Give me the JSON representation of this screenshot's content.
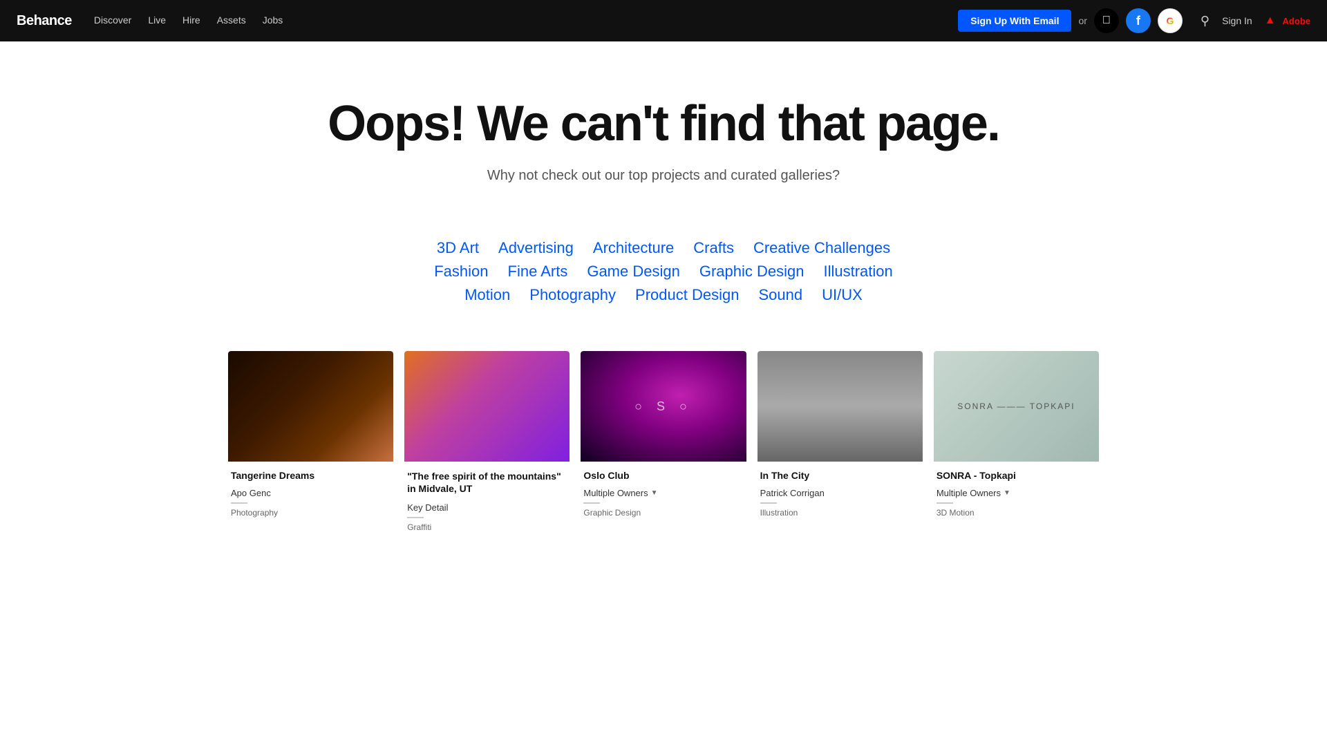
{
  "navbar": {
    "logo": "Behance",
    "links": [
      "Discover",
      "Live",
      "Hire",
      "Assets",
      "Jobs"
    ],
    "signup_label": "Sign Up With Email",
    "or_label": "or",
    "signin_label": "Sign In",
    "adobe_label": "Adobe",
    "apple_icon": "",
    "facebook_icon": "f",
    "google_icon": "G",
    "search_icon": "🔍"
  },
  "hero": {
    "title": "Oops! We can't find that page.",
    "subtitle": "Why not check out our top projects and curated galleries?"
  },
  "tags": {
    "row1": [
      "3D Art",
      "Advertising",
      "Architecture",
      "Crafts",
      "Creative Challenges"
    ],
    "row2": [
      "Fashion",
      "Fine Arts",
      "Game Design",
      "Graphic Design",
      "Illustration"
    ],
    "row3": [
      "Motion",
      "Photography",
      "Product Design",
      "Sound",
      "UI/UX"
    ]
  },
  "projects": [
    {
      "title": "Tangerine Dreams",
      "author": "Apo Genc",
      "category": "Photography",
      "thumb_class": "thumb-1"
    },
    {
      "title": "\"The free spirit of the mountains\" in Midvale, UT",
      "author": "Key Detail",
      "category": "Graffiti",
      "thumb_class": "thumb-2"
    },
    {
      "title": "Oslo Club",
      "author": "Multiple Owners",
      "category": "Graphic Design",
      "thumb_class": "thumb-3",
      "logo_text": "○ S ○"
    },
    {
      "title": "In The City",
      "author": "Patrick Corrigan",
      "category": "Illustration",
      "thumb_class": "thumb-4"
    },
    {
      "title": "SONRA - Topkapi",
      "author": "Multiple Owners",
      "category": "3D Motion",
      "thumb_class": "thumb-5",
      "logo_text": "SONRA ——— TOPKAPI"
    }
  ]
}
